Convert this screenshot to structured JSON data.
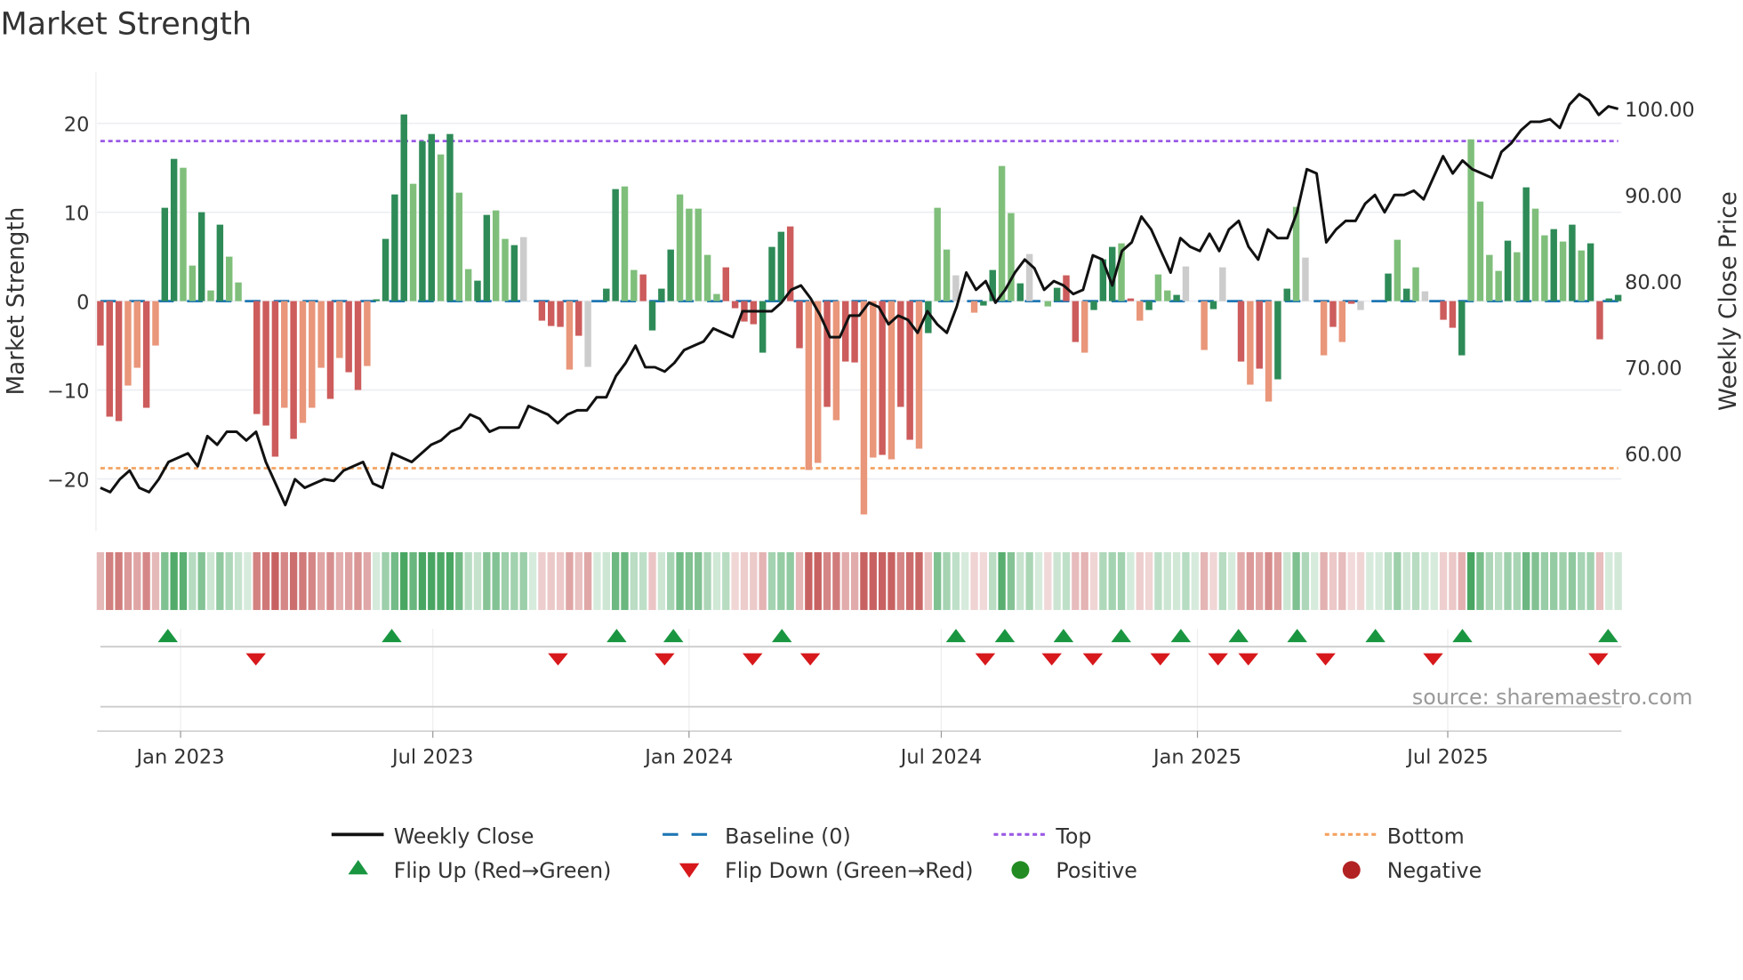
{
  "chart_data": {
    "type": "bar",
    "title": "Market Strength",
    "ylabel": "Market Strength",
    "y2label": "Weekly Close Price",
    "ylim": [
      -25,
      25
    ],
    "y2lim": [
      52.4,
      104.8
    ],
    "yticks": [
      20,
      10,
      0,
      -10,
      -20
    ],
    "ytick_labels": [
      "20",
      "10",
      "0",
      "−10",
      "−20"
    ],
    "y2ticks": [
      100,
      90,
      80,
      70,
      60
    ],
    "y2tick_labels": [
      "100.00",
      "90.00",
      "80.00",
      "70.00",
      "60.00"
    ],
    "x_unit": "week index",
    "xticks": [
      8.2,
      34,
      60.2,
      86,
      112.2,
      137.8
    ],
    "xtick_labels": [
      "Jan 2023",
      "Jul 2023",
      "Jan 2024",
      "Jul 2024",
      "Jan 2025",
      "Jul 2025"
    ],
    "top_level": 18,
    "bottom_level": -18.8,
    "baseline": 0,
    "strength": [
      -5,
      -13,
      -13.5,
      -9.5,
      -7.5,
      -12,
      -5,
      10.5,
      16,
      15,
      4,
      10,
      1.2,
      8.6,
      5,
      2.1,
      0,
      -12.7,
      -14,
      -17.5,
      -12,
      -15.5,
      -13.7,
      -12,
      -7.5,
      -11,
      -6.4,
      -8,
      -10,
      -7.3,
      0.2,
      7,
      12,
      21,
      13.2,
      18,
      18.8,
      16.5,
      18.8,
      12.2,
      3.6,
      2.3,
      9.7,
      10.2,
      7,
      6.3,
      7.2,
      0,
      -2.2,
      -2.8,
      -2.9,
      -7.7,
      -3.9,
      -7.4,
      0,
      1.4,
      12.6,
      12.9,
      3.5,
      3.0,
      -3.3,
      1.4,
      5.8,
      12,
      10.4,
      10.4,
      5.2,
      0.8,
      3.8,
      -0.8,
      -2.3,
      -2.6,
      -5.8,
      6.1,
      7.8,
      8.4,
      -5.3,
      -19,
      -18.2,
      -11.9,
      -13.4,
      -6.8,
      -6.9,
      -24,
      -17.6,
      -17.3,
      -17.8,
      -11.9,
      -15.6,
      -16.6,
      -3.6,
      10.5,
      5.8,
      2.9,
      0,
      -1.3,
      -0.5,
      3.5,
      15.2,
      9.9,
      2.0,
      5.3,
      0,
      -0.6,
      1.5,
      2.9,
      -4.6,
      -5.8,
      -1,
      4.7,
      6.1,
      6.5,
      0.3,
      -2.2,
      -1,
      3.0,
      1.2,
      0.7,
      3.9,
      0,
      -5.5,
      -0.9,
      3.8,
      0,
      -6.8,
      -9.4,
      -7.6,
      -11.3,
      -8.8,
      1.4,
      10.6,
      4.9,
      0,
      -6.1,
      -2.9,
      -4.6,
      -0.3,
      -1.0,
      0,
      0,
      3.1,
      6.9,
      1.4,
      3.8,
      1.1,
      0,
      -2.1,
      -3.0,
      -6.1,
      18.2,
      11.2,
      5.2,
      3.4,
      6.8,
      5.5,
      12.8,
      10.4,
      7.4,
      8.1,
      6.7,
      8.6,
      5.7,
      6.5,
      -4.3,
      0.3,
      0.7
    ],
    "strength_shade": "RRRrrRrGGggGgGggnRRRrRrrrRrRRrGGGGgGGgGggGGggGnRRRRrRnGGGggRGGGgggggRRRRGGGRRrrRrRRrrRrRRrGggnRrGGggGnRgGRRrGGGgRrGggGnRrGnRRrRrGGgnRrRrRnnGGgGgnRRRGggggGgGggGgGgGRGG",
    "weekly_close": [
      56,
      55.5,
      57,
      58,
      56,
      55.5,
      57,
      59,
      59.5,
      60,
      58.5,
      62,
      61,
      62.5,
      62.5,
      61.5,
      62.5,
      59,
      56.5,
      54,
      57,
      56,
      56.5,
      57,
      56.8,
      58,
      58.5,
      59,
      56.5,
      56,
      60,
      59.5,
      59,
      60,
      61,
      61.5,
      62.5,
      63,
      64.5,
      64,
      62.5,
      63,
      63,
      63,
      65.5,
      65,
      64.5,
      63.5,
      64.5,
      65,
      65,
      66.5,
      66.5,
      69,
      70.5,
      72.5,
      70,
      70,
      69.5,
      70.5,
      72,
      72.5,
      73,
      74.5,
      74,
      73.5,
      76.5,
      76.5,
      76.5,
      76.5,
      77.5,
      79,
      79.5,
      78,
      76,
      73.5,
      73.5,
      76,
      76,
      77.5,
      77,
      75,
      76,
      75.5,
      74,
      76.5,
      75,
      74,
      77,
      81,
      79,
      80,
      77.5,
      79,
      81,
      82.5,
      81.5,
      79,
      80,
      79.5,
      78.5,
      79,
      83,
      82.5,
      79.5,
      83.5,
      84.5,
      87.5,
      86,
      83.5,
      81,
      85,
      84,
      83.5,
      85.5,
      83.5,
      86,
      87,
      84,
      82.5,
      86,
      85,
      85,
      88,
      93,
      92.5,
      84.5,
      86,
      87,
      87,
      89,
      90,
      88,
      90,
      90,
      90.5,
      89.5,
      92,
      94.5,
      92.5,
      94,
      93,
      92.5,
      92,
      95,
      96,
      97.5,
      98.5,
      98.5,
      98.8,
      97.8,
      100.5,
      101.7,
      101,
      99.3,
      100.3,
      100
    ],
    "flip_up_weeks": [
      6.9,
      29.8,
      52.8,
      58.6,
      69.7,
      87.5,
      92.5,
      98.5,
      104.4,
      110.5,
      116.4,
      122.4,
      130.4,
      139.3,
      154.2
    ],
    "flip_down_weeks": [
      15.9,
      46.8,
      57.7,
      66.7,
      72.6,
      90.5,
      97.3,
      101.5,
      108.4,
      114.3,
      117.4,
      125.3,
      136.3,
      153.2
    ],
    "colors": {
      "strong_pos": "#2e8b57",
      "weak_pos": "#7fbf7b",
      "strong_neg": "#cd5c5c",
      "weak_neg": "#e9967a",
      "baseline": "#1f77b4",
      "top": "#9b59e6",
      "bottom": "#f4a261",
      "close": "#111111",
      "flip_up": "#1a9641",
      "flip_down": "#d7191c",
      "positive": "#228b22",
      "negative": "#b22222"
    },
    "legend": {
      "placement": "bottom",
      "items": [
        "Weekly Close",
        "Baseline (0)",
        "Top",
        "Bottom",
        "Flip Up (Red→Green)",
        "Flip Down (Green→Red)",
        "Positive",
        "Negative"
      ]
    },
    "annotation": "source: sharemaestro.com"
  }
}
